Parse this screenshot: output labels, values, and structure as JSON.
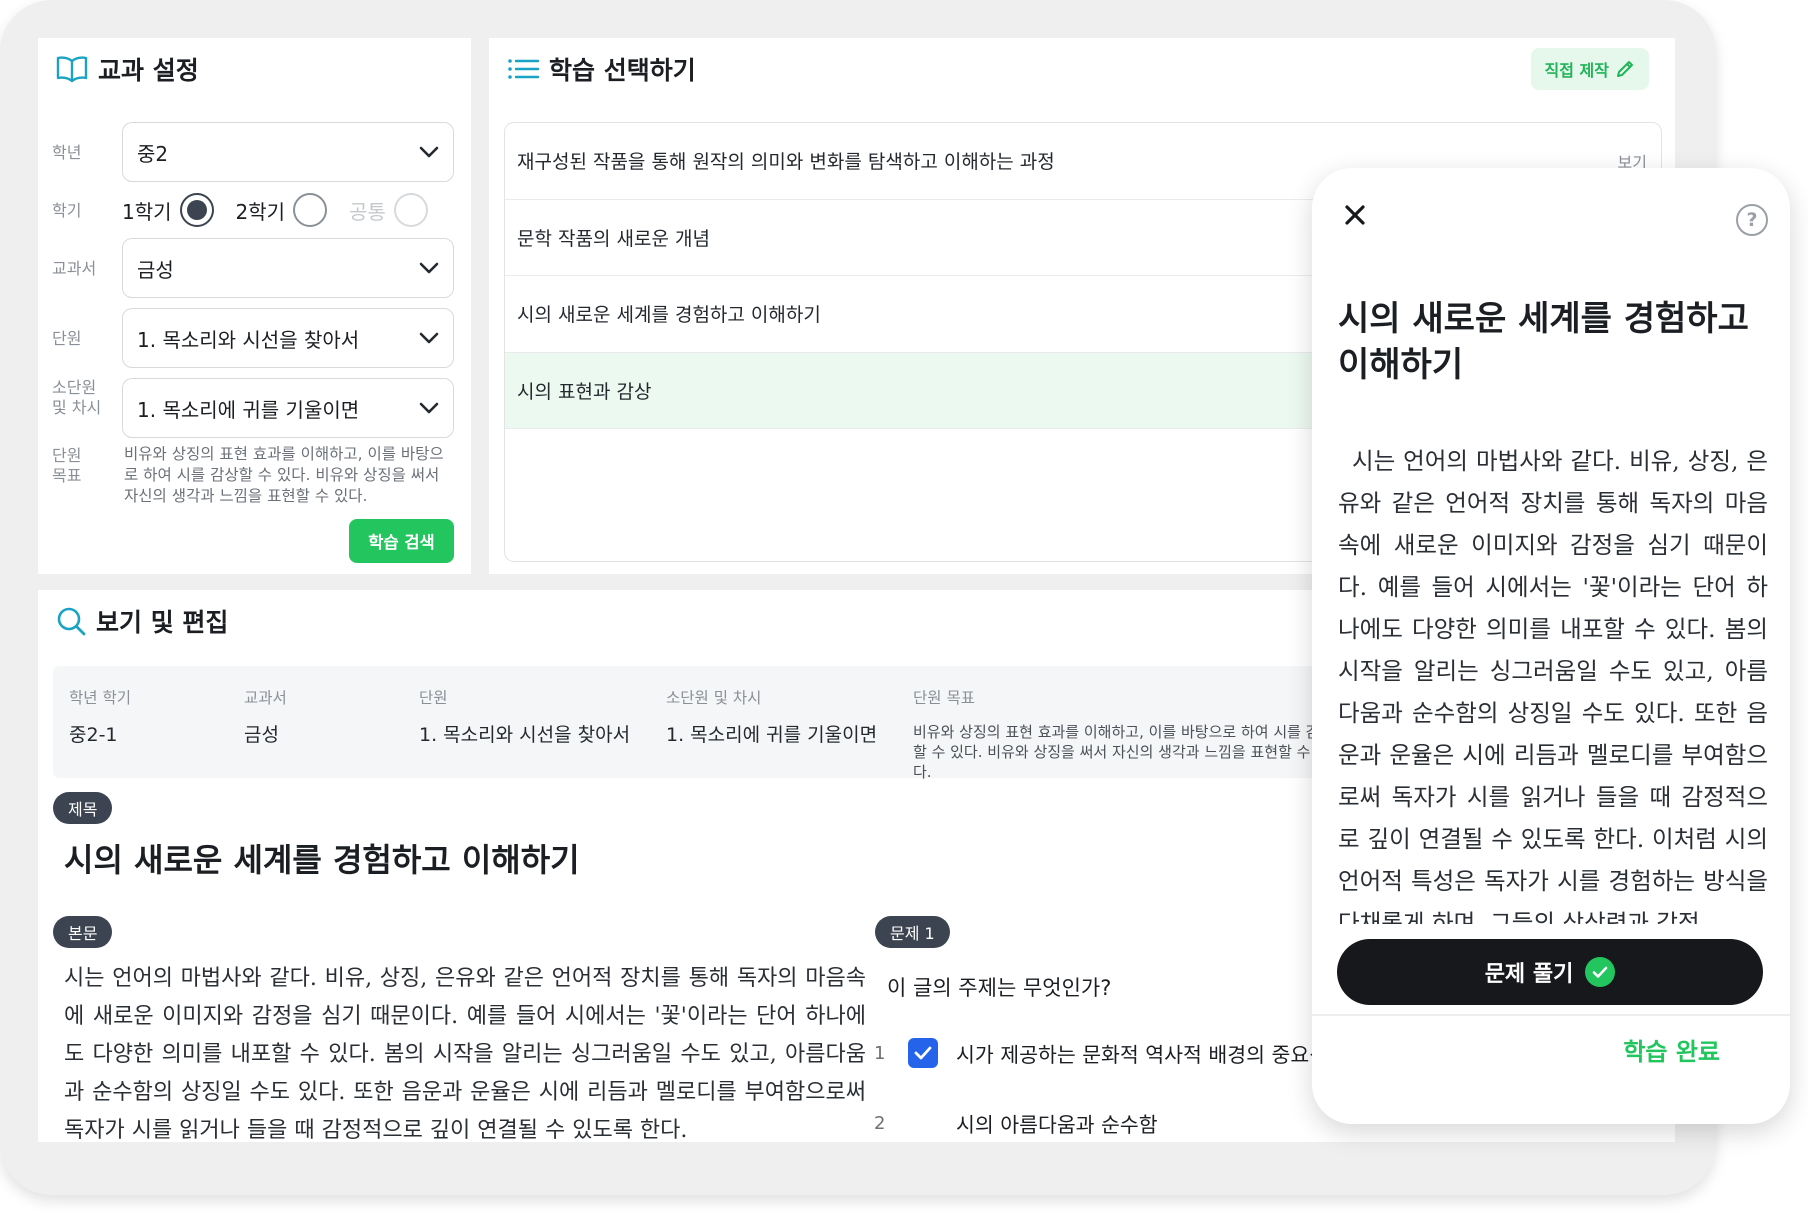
{
  "subject_settings": {
    "title": "교과 설정",
    "grade": {
      "label": "학년",
      "value": "중2"
    },
    "semester": {
      "label": "학기",
      "options": [
        {
          "label": "1학기",
          "state": "checked"
        },
        {
          "label": "2학기",
          "state": "unchecked"
        },
        {
          "label": "공통",
          "state": "disabled"
        }
      ]
    },
    "textbook": {
      "label": "교과서",
      "value": "금성"
    },
    "unit": {
      "label": "단원",
      "value": "1. 목소리와 시선을 찾아서"
    },
    "subunit": {
      "label_line1": "소단원",
      "label_line2": "및 차시",
      "value": "1. 목소리에 귀를 기울이면"
    },
    "goal": {
      "label_line1": "단원",
      "label_line2": "목표",
      "text": "비유와 상징의 표현 효과를 이해하고, 이를 바탕으로 하여 시를 감상할 수 있다. 비유와 상징을 써서 자신의 생각과 느낌을 표현할 수 있다."
    },
    "search_button": "학습 검색"
  },
  "study_select": {
    "title": "학습 선택하기",
    "direct_make_button": "직접 제작",
    "view_label": "보기",
    "items": [
      {
        "text": "재구성된 작품을 통해 원작의 의미와 변화를 탐색하고 이해하는 과정",
        "selected": false
      },
      {
        "text": "문학 작품의 새로운 개념",
        "selected": false
      },
      {
        "text": "시의 새로운 세계를 경험하고 이해하기",
        "selected": false
      },
      {
        "text": "시의 표현과 감상",
        "selected": true
      }
    ]
  },
  "view_edit": {
    "title": "보기 및 편집",
    "info": {
      "grade_semester": {
        "label": "학년 학기",
        "value": "중2-1"
      },
      "textbook": {
        "label": "교과서",
        "value": "금성"
      },
      "unit": {
        "label": "단원",
        "value": "1. 목소리와 시선을 찾아서"
      },
      "subunit": {
        "label": "소단원 및 차시",
        "value": "1. 목소리에 귀를 기울이면"
      },
      "goal": {
        "label": "단원 목표",
        "value": "비유와 상징의 표현 효과를 이해하고, 이를 바탕으로 하여 시를 감상할 수 있다. 비유와 상징을 써서 자신의 생각과 느낌을 표현할 수 있다."
      }
    },
    "title_tag": "제목",
    "doc_title": "시의 새로운 세계를 경험하고 이해하기",
    "body_tag": "본문",
    "body_text": "시는 언어의 마법사와 같다. 비유, 상징, 은유와 같은 언어적 장치를 통해 독자의 마음속에 새로운 이미지와 감정을 심기 때문이다. 예를 들어 시에서는 '꽃'이라는 단어 하나에도 다양한 의미를 내포할 수 있다. 봄의 시작을 알리는 싱그러움일 수도 있고, 아름다움과 순수함의 상징일 수도 있다. 또한 음운과 운율은 시에 리듬과 멜로디를 부여함으로써 독자가 시를 읽거나 들을 때 감정적으로 깊이 연결될 수 있도록 한다.",
    "question_tag": "문제 1",
    "question": "이 글의 주제는 무엇인가?",
    "choices": [
      {
        "num": "1",
        "text": "시가 제공하는 문화적 역사적 배경의 중요성",
        "checked": true
      },
      {
        "num": "2",
        "text": "시의 아름다움과 순수함",
        "checked": false
      }
    ]
  },
  "reader_modal": {
    "title": "시의 새로운 세계를 경험하고 이해하기",
    "body": "시는 언어의 마법사와 같다. 비유, 상징, 은유와 같은 언어적 장치를 통해 독자의 마음속에 새로운 이미지와 감정을 심기 때문이다. 예를 들어 시에서는 '꽃'이라는 단어 하나에도 다양한 의미를 내포할 수 있다. 봄의 시작을 알리는 싱그러움일 수도 있고, 아름다움과 순수함의 상징일 수도 있다. 또한 음운과 운율은 시에 리듬과 멜로디를 부여함으로써 독자가 시를 읽거나 들을 때 감정적으로 깊이 연결될 수 있도록 한다. 이처럼 시의 언어적 특성은 독자가 시를 경험하는 방식을 다채롭게 하며, 그들의 상상력과 감정",
    "solve_button": "문제 풀기",
    "complete_button": "학습 완료",
    "help_icon_text": "?"
  },
  "colors": {
    "accent_green": "#22c55e",
    "selected_row_bg": "#ecf9f0",
    "checkbox_blue": "#2563eb",
    "tag_dark": "#3b4450",
    "icon_teal": "#1aa3c2"
  }
}
